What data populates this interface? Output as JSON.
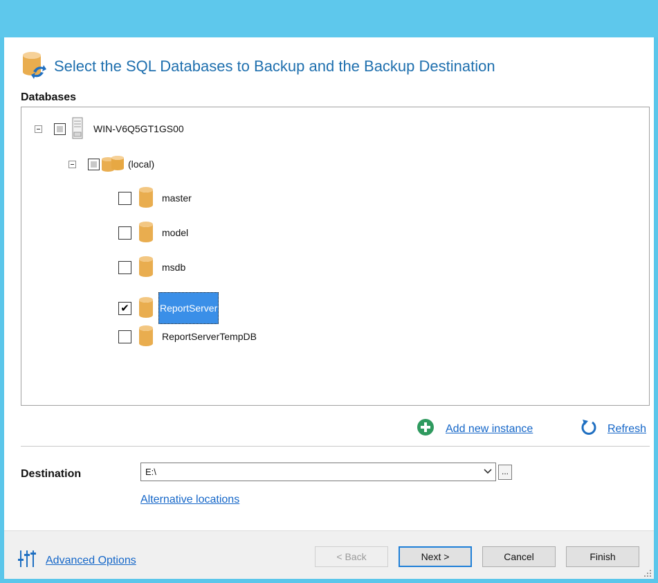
{
  "header": {
    "title": "Select the SQL Databases to Backup and the Backup Destination"
  },
  "databases": {
    "label": "Databases",
    "server": {
      "name": "WIN-V6Q5GT1GS00",
      "checked": "partial"
    },
    "instance": {
      "name": "(local)",
      "checked": "partial"
    },
    "items": [
      {
        "name": "master",
        "checked": false,
        "selected": false
      },
      {
        "name": "model",
        "checked": false,
        "selected": false
      },
      {
        "name": "msdb",
        "checked": false,
        "selected": false
      },
      {
        "name": "ReportServer",
        "checked": true,
        "selected": true
      },
      {
        "name": "ReportServerTempDB",
        "checked": false,
        "selected": false
      }
    ]
  },
  "actions": {
    "add_instance": "Add new instance",
    "refresh": "Refresh"
  },
  "destination": {
    "label": "Destination",
    "value": "E:\\",
    "browse_label": "...",
    "alternative_link": "Alternative locations"
  },
  "footer": {
    "advanced_options": "Advanced Options",
    "back": "< Back",
    "next": "Next >",
    "cancel": "Cancel",
    "finish": "Finish"
  },
  "colors": {
    "title_bar": "#5ec8ec",
    "header_text": "#1e6fae",
    "selection": "#3a8fe8",
    "link": "#1466c8",
    "db_icon": "#e9ad4f",
    "add_icon": "#2f9a5f"
  },
  "icons": {
    "header": "database-sync-icon",
    "server": "server-icon",
    "instance": "instance-databases-icon",
    "database": "database-icon",
    "add": "add-circle-icon",
    "refresh": "refresh-icon",
    "advanced": "sliders-icon"
  }
}
